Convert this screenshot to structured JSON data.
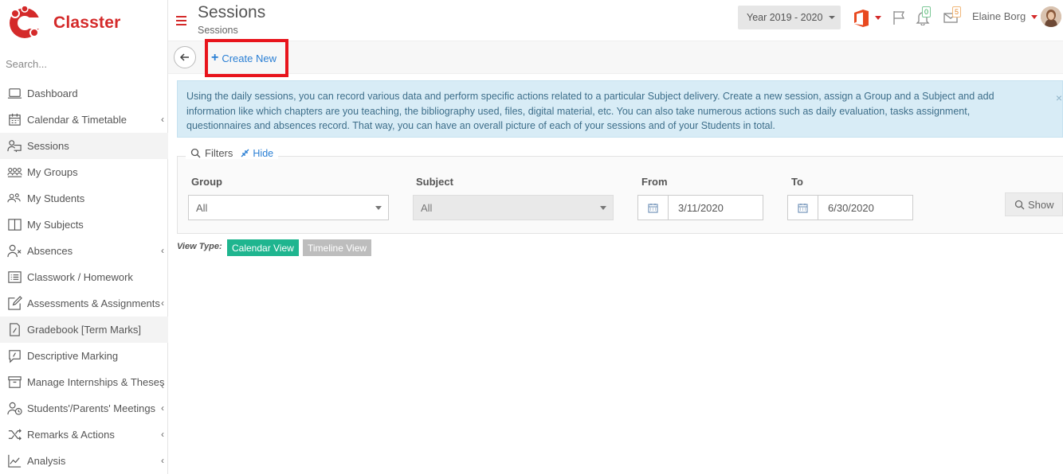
{
  "brand": {
    "name": "Classter",
    "color": "#d42a2a"
  },
  "search": {
    "placeholder": "Search..."
  },
  "sidebar": {
    "items": [
      {
        "label": "Dashboard",
        "icon": "laptop-icon",
        "arrow": false
      },
      {
        "label": "Calendar & Timetable",
        "icon": "calendar-icon",
        "arrow": true
      },
      {
        "label": "Sessions",
        "icon": "presentation-icon",
        "arrow": false,
        "active": true
      },
      {
        "label": "My Groups",
        "icon": "groups-icon",
        "arrow": false
      },
      {
        "label": "My Students",
        "icon": "students-icon",
        "arrow": false
      },
      {
        "label": "My Subjects",
        "icon": "book-icon",
        "arrow": false
      },
      {
        "label": "Absences",
        "icon": "user-x-icon",
        "arrow": true
      },
      {
        "label": "Classwork / Homework",
        "icon": "list-icon",
        "arrow": false
      },
      {
        "label": "Assessments & Assignments",
        "icon": "edit-icon",
        "arrow": true
      },
      {
        "label": "Gradebook [Term Marks]",
        "icon": "gradebook-icon",
        "arrow": false,
        "active": true
      },
      {
        "label": "Descriptive Marking",
        "icon": "descriptive-icon",
        "arrow": false
      },
      {
        "label": "Manage Internships & Theses",
        "icon": "archive-icon",
        "arrow": true
      },
      {
        "label": "Students'/Parents' Meetings",
        "icon": "meeting-icon",
        "arrow": true
      },
      {
        "label": "Remarks & Actions",
        "icon": "shuffle-icon",
        "arrow": true
      },
      {
        "label": "Analysis",
        "icon": "chart-icon",
        "arrow": true
      }
    ]
  },
  "header": {
    "title": "Sessions",
    "subtitle": "Sessions",
    "year": "Year 2019 - 2020",
    "notifications_count": "0",
    "messages_count": "5",
    "user_name": "Elaine Borg"
  },
  "toolbar": {
    "create_label": "Create New"
  },
  "alert": {
    "text": "Using the daily sessions, you can record various data and perform specific actions related to a particular Subject delivery. Create a new session, assign a Group and a Subject and add information like which chapters are you teaching, the bibliography used, files, digital material, etc. You can also take numerous actions such as daily evaluation, tasks assignment, questionnaires and absences record. That way, you can have an overall picture of each of your sessions and of your Students in total."
  },
  "filters": {
    "title": "Filters",
    "hide_label": "Hide",
    "group_label": "Group",
    "group_value": "All",
    "subject_label": "Subject",
    "subject_value": "All",
    "from_label": "From",
    "from_value": "3/11/2020",
    "to_label": "To",
    "to_value": "6/30/2020",
    "show_label": "Show"
  },
  "view": {
    "label": "View Type:",
    "calendar_label": "Calendar View",
    "timeline_label": "Timeline View",
    "active_color": "#1fb58f",
    "inactive_color": "#bdbdbd"
  }
}
